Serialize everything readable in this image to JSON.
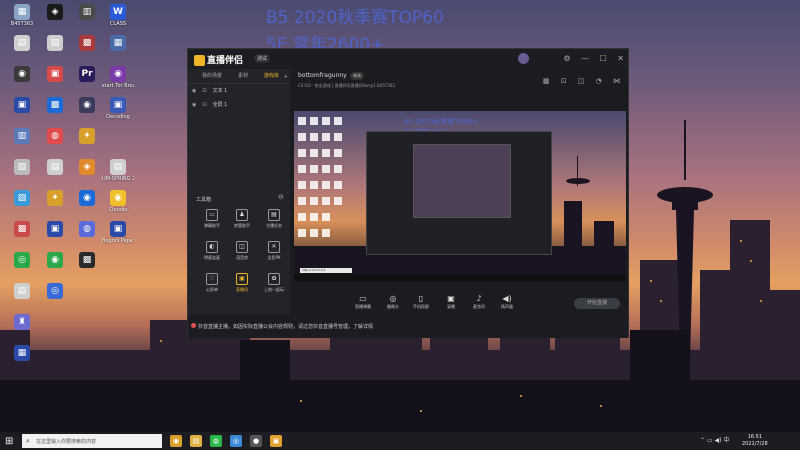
{
  "overlay": {
    "line1": "B5 2020秋季赛TOP60",
    "line2": "5E 常年2600+"
  },
  "desktop_icons": [
    {
      "label": "B45T363",
      "glyph": "▦",
      "color": "#8aa4c8"
    },
    {
      "label": "",
      "glyph": "▤",
      "color": "#cfcfcf"
    },
    {
      "label": "",
      "glyph": "◉",
      "color": "#3a3a3a"
    },
    {
      "label": "",
      "glyph": "▣",
      "color": "#2a4aa8"
    },
    {
      "label": "",
      "glyph": "▥",
      "color": "#5a7ab8"
    },
    {
      "label": "",
      "glyph": "▧",
      "color": "#bbbbbb"
    },
    {
      "label": "",
      "glyph": "▨",
      "color": "#3a9ad9"
    },
    {
      "label": "",
      "glyph": "▩",
      "color": "#c84a4a"
    },
    {
      "label": "",
      "glyph": "◎",
      "color": "#2aa84a"
    },
    {
      "label": "",
      "glyph": "▤",
      "color": "#cfcfcf"
    },
    {
      "label": "",
      "glyph": "♜",
      "color": "#6a6ad0"
    },
    {
      "label": "",
      "glyph": "▦",
      "color": "#2a4aa8"
    },
    {
      "label": "",
      "glyph": "◈",
      "color": "#1a1a1a"
    },
    {
      "label": "",
      "glyph": "▤",
      "color": "#cfcfcf"
    },
    {
      "label": "",
      "glyph": "▣",
      "color": "#d84a4a"
    },
    {
      "label": "",
      "glyph": "▩",
      "color": "#1a6ad8"
    },
    {
      "label": "",
      "glyph": "◍",
      "color": "#e04a4a"
    },
    {
      "label": "",
      "glyph": "▤",
      "color": "#cfcfcf"
    },
    {
      "label": "",
      "glyph": "✦",
      "color": "#d8a02a"
    },
    {
      "label": "",
      "glyph": "▣",
      "color": "#2a4aa8"
    },
    {
      "label": "",
      "glyph": "◉",
      "color": "#2aa84a"
    },
    {
      "label": "",
      "glyph": "◎",
      "color": "#3a6ad8"
    },
    {
      "label": "",
      "glyph": "▥",
      "color": "#4a4a4a"
    },
    {
      "label": "",
      "glyph": "▩",
      "color": "#a83a3a"
    },
    {
      "label": "",
      "glyph": "Pr",
      "color": "#2a1a5a"
    },
    {
      "label": "",
      "glyph": "◉",
      "color": "#3a3a5a"
    },
    {
      "label": "",
      "glyph": "✦",
      "color": "#d8a02a"
    },
    {
      "label": "",
      "glyph": "◈",
      "color": "#e08a2a"
    },
    {
      "label": "",
      "glyph": "◉",
      "color": "#1a6ad8"
    },
    {
      "label": "",
      "glyph": "◍",
      "color": "#5a6ad8"
    },
    {
      "label": "",
      "glyph": "▩",
      "color": "#2a2a2a"
    },
    {
      "label": "CLASS",
      "glyph": "W",
      "color": "#2a5ad8"
    },
    {
      "label": "",
      "glyph": "▦",
      "color": "#4a6aa8"
    },
    {
      "label": "start Tor Browser",
      "glyph": "◉",
      "color": "#7a3aa8"
    },
    {
      "label": "Decoding",
      "glyph": "▣",
      "color": "#3a5ab8"
    },
    {
      "label": "",
      "glyph": "",
      "color": "rgba(0,0,0,0)"
    },
    {
      "label": "UM-SPRING 20",
      "glyph": "▤",
      "color": "#cfcfcf"
    },
    {
      "label": "Cloudio",
      "glyph": "◉",
      "color": "#f0c02a"
    },
    {
      "label": "Bogoni Pepe's Ne",
      "glyph": "▣",
      "color": "#2a4aa8"
    }
  ],
  "app": {
    "logo_text": "直播伴侣",
    "badge": "测试",
    "tabs": [
      "我的场景",
      "素材",
      "游戏库"
    ],
    "active_tab": 2,
    "scenes": [
      "文本 1",
      "全屏 1"
    ],
    "tools_header": "工具箱",
    "tools": [
      {
        "label": "弹幕助手",
        "glyph": "▭"
      },
      {
        "label": "房管助手",
        "glyph": "♟"
      },
      {
        "label": "主播任务",
        "glyph": "▤"
      },
      {
        "label": "明星连麦",
        "glyph": "◐"
      },
      {
        "label": "语音房",
        "glyph": "◫"
      },
      {
        "label": "全民PK",
        "glyph": "✕"
      },
      {
        "label": "心愿单",
        "glyph": "♡"
      },
      {
        "label": "直播间",
        "glyph": "▣",
        "orange": true
      },
      {
        "label": "上热一起玩",
        "glyph": "✿"
      }
    ],
    "streamer_name": "bottomfragunny",
    "edit_label": "修改",
    "stream_sub": "CS:GO · 射击游戏  |  直播间号直播间Yamy1  B45T363",
    "controls": [
      {
        "label": "直播弹幕",
        "glyph": "▭"
      },
      {
        "label": "摄像头",
        "glyph": "◎"
      },
      {
        "label": "手机投屏",
        "glyph": "▯"
      },
      {
        "label": "录播",
        "glyph": "▣"
      },
      {
        "label": "麦克风",
        "glyph": "♪"
      },
      {
        "label": "扬声器",
        "glyph": "◀)"
      }
    ],
    "start_label": "开始直播",
    "stats": [
      "码率:0kb/s",
      "FPS:0",
      "丢帧:0.00%",
      "CPU:20%",
      "内存:43%"
    ],
    "notice": "抖音直播主播，如因实际直播公会内容规则，请过您抖音直播号管理，了解详情",
    "preview_overlay1": "B5 2020秋季赛TOP60",
    "preview_overlay2": "5E 常年2600+",
    "preview_address": "http://172.0.0.1"
  },
  "taskbar": {
    "search_placeholder": "在这里输入你要搜索的内容",
    "apps": [
      {
        "name": "chrome",
        "glyph": "◉",
        "color": "#d8a02a"
      },
      {
        "name": "file-explorer",
        "glyph": "▤",
        "color": "#e0b040"
      },
      {
        "name": "wechat",
        "glyph": "◍",
        "color": "#2ab84a"
      },
      {
        "name": "browser",
        "glyph": "◎",
        "color": "#3a8ad8"
      },
      {
        "name": "obs",
        "glyph": "●",
        "color": "#555"
      },
      {
        "name": "live-companion",
        "glyph": "▣",
        "color": "#e0a030"
      }
    ],
    "clock_time": "16:51",
    "clock_date": "2021/7/28",
    "tray_icons": "⌃ ▭ ◀) 中"
  },
  "colors": {
    "overlay_text": "#4f63c9",
    "accent": "#f0b429"
  }
}
